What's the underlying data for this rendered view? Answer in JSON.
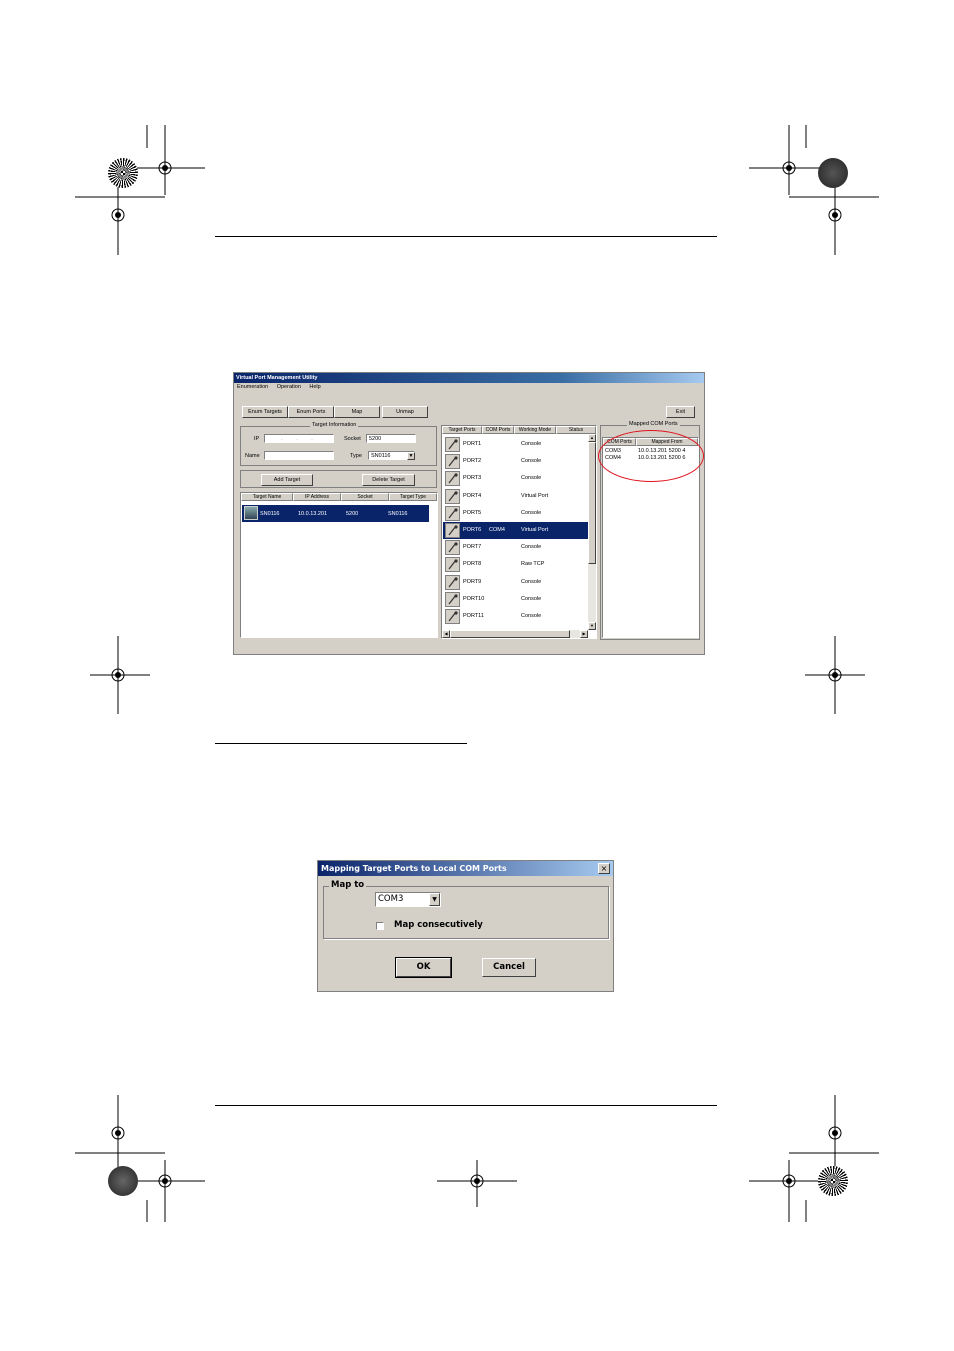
{
  "app": {
    "title": "Virtual Port Management Utility",
    "menus": [
      "Enumeration",
      "Operation",
      "Help"
    ],
    "toolbar": {
      "enum_targets": "Enum Targets",
      "enum_ports": "Enum Ports",
      "map": "Map",
      "unmap": "Unmap",
      "exit": "Exit"
    },
    "target_info": {
      "group_title": "Target Information",
      "ip_label": "IP",
      "ip_value": ". . .",
      "socket_label": "Socket",
      "socket_value": "5200",
      "name_label": "Name",
      "name_value": "",
      "type_label": "Type",
      "type_value": "SN0116"
    },
    "add_target": "Add Target",
    "delete_target": "Delete Target",
    "targets_table": {
      "headers": [
        "Target Name",
        "IP Address",
        "Socket",
        "Target Type"
      ],
      "rows": [
        {
          "name": "SN0116",
          "ip": "10.0.13.201",
          "socket": "5200",
          "type": "SN0116"
        }
      ]
    },
    "ports_table": {
      "headers": [
        "Target Ports",
        "COM Ports",
        "Working Mode",
        "Status"
      ],
      "rows": [
        {
          "port": "PORT1",
          "com": "",
          "mode": "Console",
          "selected": false
        },
        {
          "port": "PORT2",
          "com": "",
          "mode": "Console",
          "selected": false
        },
        {
          "port": "PORT3",
          "com": "",
          "mode": "Console",
          "selected": false
        },
        {
          "port": "PORT4",
          "com": "",
          "mode": "Virtual Port",
          "selected": false
        },
        {
          "port": "PORT5",
          "com": "",
          "mode": "Console",
          "selected": false
        },
        {
          "port": "PORT6",
          "com": "COM4",
          "mode": "Virtual Port",
          "selected": true
        },
        {
          "port": "PORT7",
          "com": "",
          "mode": "Console",
          "selected": false
        },
        {
          "port": "PORT8",
          "com": "",
          "mode": "Raw TCP",
          "selected": false
        },
        {
          "port": "PORT9",
          "com": "",
          "mode": "Console",
          "selected": false
        },
        {
          "port": "PORT10",
          "com": "",
          "mode": "Console",
          "selected": false
        },
        {
          "port": "PORT11",
          "com": "",
          "mode": "Console",
          "selected": false
        }
      ]
    },
    "mapped_com": {
      "title": "Mapped COM Ports",
      "headers": [
        "COM Ports",
        "Mapped From"
      ],
      "rows": [
        {
          "com": "COM3",
          "from": "10.0.13.201 5200 4"
        },
        {
          "com": "COM4",
          "from": "10.0.13.201 5200 6"
        }
      ]
    }
  },
  "dialog": {
    "title": "Mapping Target Ports to Local COM Ports",
    "close": "×",
    "group_title": "Map to",
    "select_value": "COM3",
    "checkbox_label": "Map consecutively",
    "checkbox_checked": false,
    "ok": "OK",
    "cancel": "Cancel"
  },
  "colors": {
    "highlight_circle": "#e0141e",
    "selection": "#0a246a",
    "window_bg": "#d4d0c8"
  }
}
